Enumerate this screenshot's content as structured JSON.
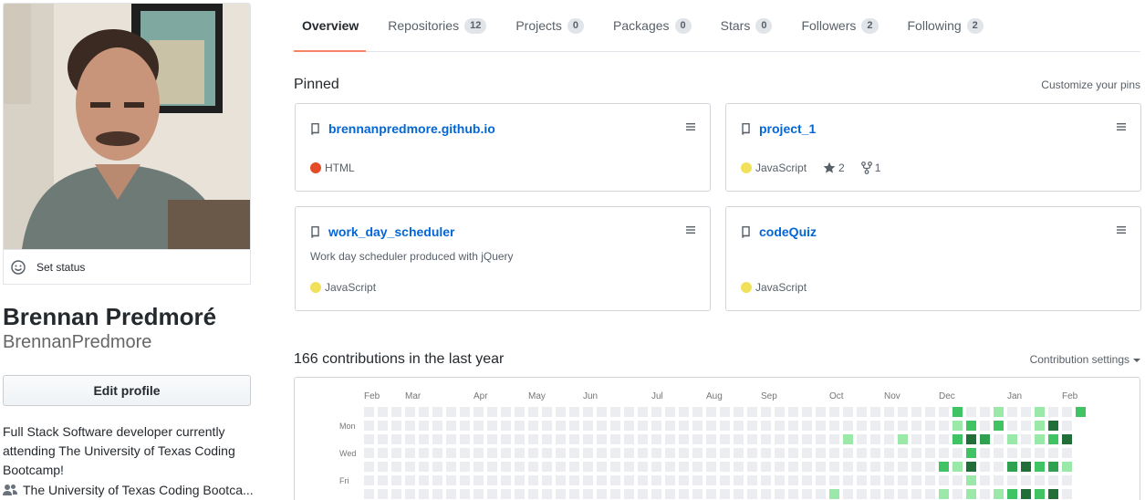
{
  "profile": {
    "set_status_label": "Set status",
    "full_name": "Brennan Predmoré",
    "username": "BrennanPredmore",
    "edit_profile_label": "Edit profile",
    "bio": "Full Stack Software developer currently attending The University of Texas Coding Bootcamp!",
    "organization": "The University of Texas Coding Bootca..."
  },
  "tabs": [
    {
      "label": "Overview",
      "count": null,
      "active": true
    },
    {
      "label": "Repositories",
      "count": "12"
    },
    {
      "label": "Projects",
      "count": "0"
    },
    {
      "label": "Packages",
      "count": "0"
    },
    {
      "label": "Stars",
      "count": "0"
    },
    {
      "label": "Followers",
      "count": "2"
    },
    {
      "label": "Following",
      "count": "2"
    }
  ],
  "pinned": {
    "title": "Pinned",
    "customize_label": "Customize your pins",
    "repos": [
      {
        "name": "brennanpredmore.github.io",
        "description": "",
        "language": "HTML",
        "language_color": "#e34c26",
        "stars": null,
        "forks": null
      },
      {
        "name": "project_1",
        "description": "",
        "language": "JavaScript",
        "language_color": "#f1e05a",
        "stars": "2",
        "forks": "1"
      },
      {
        "name": "work_day_scheduler",
        "description": "Work day scheduler produced with jQuery",
        "language": "JavaScript",
        "language_color": "#f1e05a",
        "stars": null,
        "forks": null
      },
      {
        "name": "codeQuiz",
        "description": "",
        "language": "JavaScript",
        "language_color": "#f1e05a",
        "stars": null,
        "forks": null
      }
    ]
  },
  "contributions": {
    "title": "166 contributions in the last year",
    "settings_label": "Contribution settings",
    "months": [
      {
        "label": "Feb",
        "week": 0
      },
      {
        "label": "Mar",
        "week": 3
      },
      {
        "label": "Apr",
        "week": 8
      },
      {
        "label": "May",
        "week": 12
      },
      {
        "label": "Jun",
        "week": 16
      },
      {
        "label": "Jul",
        "week": 21
      },
      {
        "label": "Aug",
        "week": 25
      },
      {
        "label": "Sep",
        "week": 29
      },
      {
        "label": "Oct",
        "week": 34
      },
      {
        "label": "Nov",
        "week": 38
      },
      {
        "label": "Dec",
        "week": 42
      },
      {
        "label": "Jan",
        "week": 47
      },
      {
        "label": "Feb",
        "week": 51
      }
    ],
    "day_labels": [
      {
        "label": "Mon",
        "day": 1
      },
      {
        "label": "Wed",
        "day": 3
      },
      {
        "label": "Fri",
        "day": 5
      }
    ],
    "weeks": 53,
    "colors": [
      "#ebedf0",
      "#9be9a8",
      "#40c463",
      "#30a14e",
      "#216e39"
    ],
    "levels": {
      "34": [
        0,
        0,
        0,
        0,
        0,
        0,
        1
      ],
      "35": [
        0,
        0,
        1,
        0,
        0,
        0,
        0
      ],
      "39": [
        0,
        0,
        1,
        0,
        0,
        0,
        0
      ],
      "42": [
        0,
        0,
        0,
        0,
        2,
        0,
        1
      ],
      "43": [
        2,
        1,
        2,
        0,
        1,
        0,
        0
      ],
      "44": [
        0,
        2,
        4,
        2,
        4,
        1,
        1
      ],
      "45": [
        0,
        0,
        3,
        0,
        0,
        0,
        0
      ],
      "46": [
        1,
        2,
        0,
        0,
        0,
        0,
        1
      ],
      "47": [
        0,
        0,
        1,
        0,
        3,
        0,
        2
      ],
      "48": [
        0,
        0,
        0,
        0,
        4,
        0,
        4
      ],
      "49": [
        1,
        1,
        1,
        0,
        2,
        0,
        2
      ],
      "50": [
        0,
        4,
        2,
        0,
        3,
        0,
        4
      ],
      "51": [
        0,
        0,
        4,
        0,
        1,
        0,
        0
      ],
      "52": [
        2,
        0,
        0,
        0,
        0,
        0,
        0
      ]
    }
  }
}
